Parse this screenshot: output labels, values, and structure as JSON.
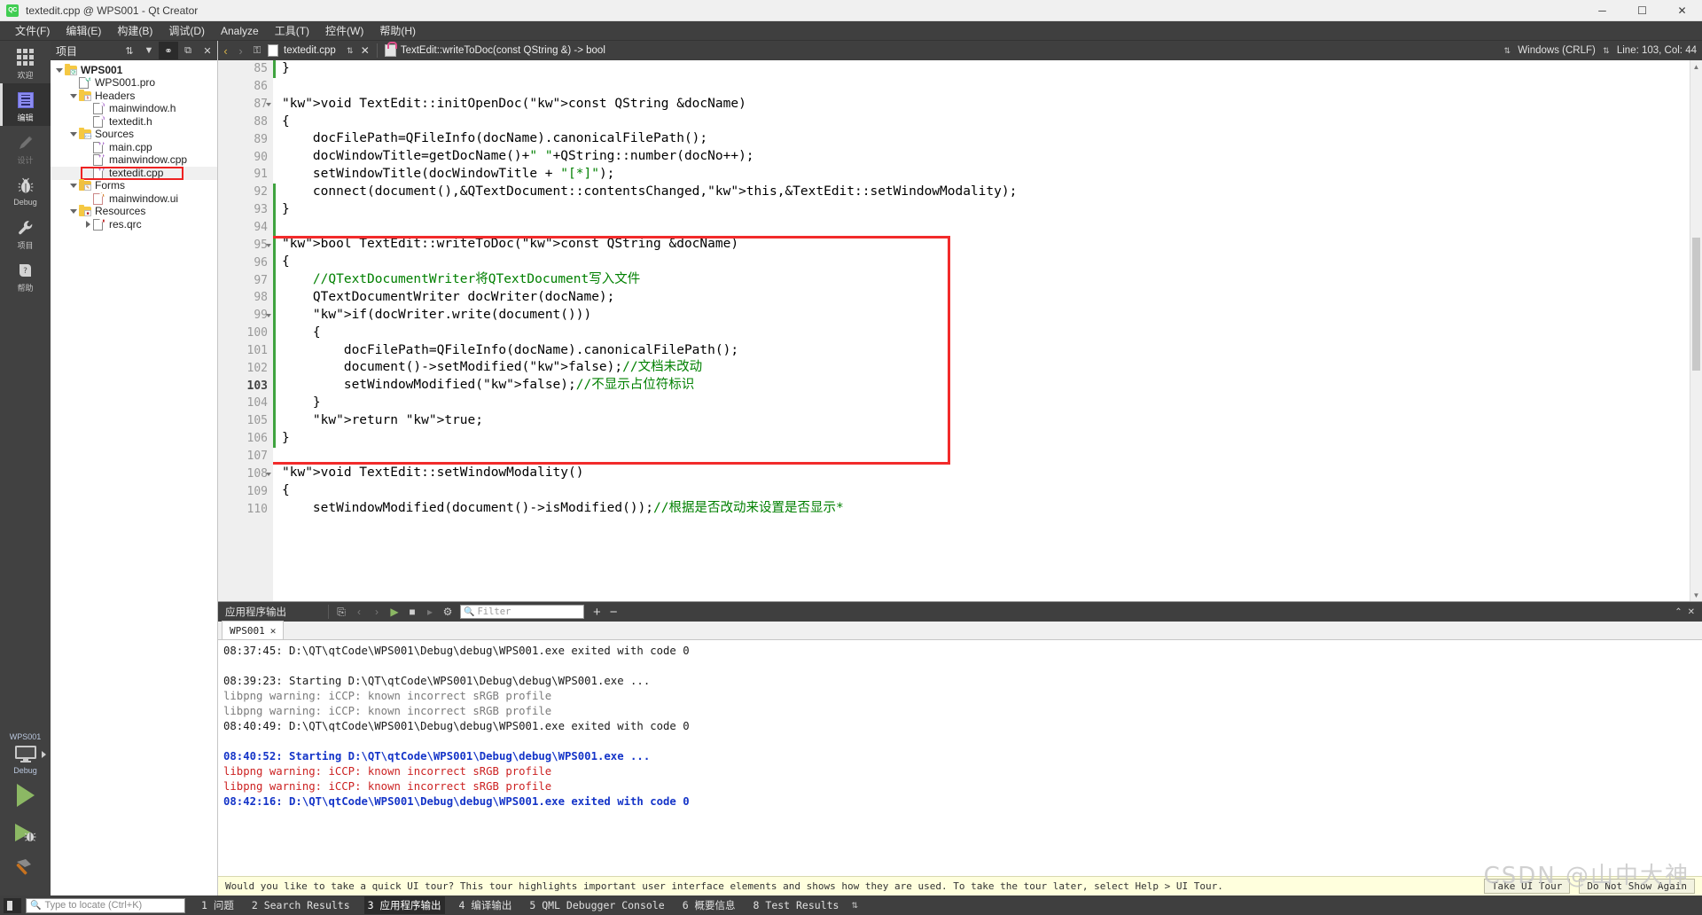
{
  "window": {
    "title": "textedit.cpp @ WPS001 - Qt Creator",
    "logo_text": "QC",
    "minimize": "─",
    "maximize": "☐",
    "close": "✕"
  },
  "menubar": {
    "items": [
      {
        "label": "文件(F)",
        "name": "menu-file"
      },
      {
        "label": "编辑(E)",
        "name": "menu-edit"
      },
      {
        "label": "构建(B)",
        "name": "menu-build"
      },
      {
        "label": "调试(D)",
        "name": "menu-debug"
      },
      {
        "label": "Analyze",
        "name": "menu-analyze"
      },
      {
        "label": "工具(T)",
        "name": "menu-tools"
      },
      {
        "label": "控件(W)",
        "name": "menu-window"
      },
      {
        "label": "帮助(H)",
        "name": "menu-help"
      }
    ]
  },
  "modebar": {
    "modes": [
      {
        "label": "欢迎",
        "icon": "grid-icon",
        "active": false,
        "disabled": false
      },
      {
        "label": "编辑",
        "icon": "document-icon",
        "active": true,
        "disabled": false
      },
      {
        "label": "设计",
        "icon": "pencil-icon",
        "active": false,
        "disabled": true
      },
      {
        "label": "Debug",
        "icon": "bug-icon",
        "active": false,
        "disabled": false
      },
      {
        "label": "项目",
        "icon": "wrench-icon",
        "active": false,
        "disabled": false
      },
      {
        "label": "帮助",
        "icon": "help-icon",
        "active": false,
        "disabled": false
      }
    ],
    "kit": {
      "project_name": "WPS001",
      "build_config": "Debug"
    },
    "run_buttons": [
      {
        "name": "run-button",
        "label": "Run"
      },
      {
        "name": "start-debugging-button",
        "label": "Start Debugging"
      },
      {
        "name": "build-button",
        "label": "Build"
      }
    ]
  },
  "project_dock": {
    "title": "项目",
    "toolbar": [
      {
        "name": "sort-toggle-button",
        "glyph": "⇅"
      },
      {
        "name": "filter-button",
        "glyph": "▼"
      },
      {
        "name": "link-with-editor-button",
        "glyph": "⚭",
        "active": true
      },
      {
        "name": "split-button",
        "glyph": "⧉"
      },
      {
        "name": "close-sidebar-button",
        "glyph": "✕"
      }
    ],
    "tree": [
      {
        "label": "WPS001",
        "indent": 0,
        "twisty": "down",
        "icon": "project-folder-icon",
        "bold": true,
        "selected": false,
        "highlight": false
      },
      {
        "label": "WPS001.pro",
        "indent": 1,
        "twisty": "none",
        "icon": "pro-file-icon",
        "bold": false,
        "selected": false,
        "highlight": false
      },
      {
        "label": "Headers",
        "indent": 1,
        "twisty": "down",
        "icon": "headers-folder-icon",
        "bold": false,
        "selected": false,
        "highlight": false
      },
      {
        "label": "mainwindow.h",
        "indent": 2,
        "twisty": "none",
        "icon": "h-file-icon",
        "bold": false,
        "selected": false,
        "highlight": false
      },
      {
        "label": "textedit.h",
        "indent": 2,
        "twisty": "none",
        "icon": "h-file-icon",
        "bold": false,
        "selected": false,
        "highlight": false
      },
      {
        "label": "Sources",
        "indent": 1,
        "twisty": "down",
        "icon": "sources-folder-icon",
        "bold": false,
        "selected": false,
        "highlight": false
      },
      {
        "label": "main.cpp",
        "indent": 2,
        "twisty": "none",
        "icon": "cpp-file-icon",
        "bold": false,
        "selected": false,
        "highlight": false
      },
      {
        "label": "mainwindow.cpp",
        "indent": 2,
        "twisty": "none",
        "icon": "cpp-file-icon",
        "bold": false,
        "selected": false,
        "highlight": false
      },
      {
        "label": "textedit.cpp",
        "indent": 2,
        "twisty": "none",
        "icon": "cpp-file-icon",
        "bold": false,
        "selected": true,
        "highlight": true
      },
      {
        "label": "Forms",
        "indent": 1,
        "twisty": "down",
        "icon": "forms-folder-icon",
        "bold": false,
        "selected": false,
        "highlight": false
      },
      {
        "label": "mainwindow.ui",
        "indent": 2,
        "twisty": "none",
        "icon": "ui-file-icon",
        "bold": false,
        "selected": false,
        "highlight": false
      },
      {
        "label": "Resources",
        "indent": 1,
        "twisty": "down",
        "icon": "resources-folder-icon",
        "bold": false,
        "selected": false,
        "highlight": false
      },
      {
        "label": "res.qrc",
        "indent": 2,
        "twisty": "right",
        "icon": "qrc-file-icon",
        "bold": false,
        "selected": false,
        "highlight": false
      }
    ]
  },
  "editor_toolbar": {
    "back_glyph": "‹",
    "forward_glyph": "›",
    "lock_glyph": "⚿",
    "tab_name": "textedit.cpp",
    "combo_glyph": "⇅",
    "close_glyph": "✕",
    "symbol": "TextEdit::writeToDoc(const QString &) -> bool",
    "line_ending": "Windows (CRLF)",
    "cursor_pos": "Line: 103, Col: 44",
    "split_glyph": "⇅"
  },
  "code": {
    "first_line": 85,
    "current_line": 103,
    "lines": [
      {
        "n": 85,
        "fold": "",
        "text": "}",
        "changed": true
      },
      {
        "n": 86,
        "fold": "",
        "text": "",
        "changed": false
      },
      {
        "n": 87,
        "fold": "down",
        "text": "void TextEdit::initOpenDoc(const QString &docName)",
        "changed": false
      },
      {
        "n": 88,
        "fold": "",
        "text": "{",
        "changed": false
      },
      {
        "n": 89,
        "fold": "",
        "text": "    docFilePath=QFileInfo(docName).canonicalFilePath();",
        "changed": false
      },
      {
        "n": 90,
        "fold": "",
        "text": "    docWindowTitle=getDocName()+\" \"+QString::number(docNo++);",
        "changed": false
      },
      {
        "n": 91,
        "fold": "",
        "text": "    setWindowTitle(docWindowTitle + \"[*]\");",
        "changed": false
      },
      {
        "n": 92,
        "fold": "",
        "text": "    connect(document(),&QTextDocument::contentsChanged,this,&TextEdit::setWindowModality);",
        "changed": true
      },
      {
        "n": 93,
        "fold": "",
        "text": "}",
        "changed": true
      },
      {
        "n": 94,
        "fold": "",
        "text": "",
        "changed": true
      },
      {
        "n": 95,
        "fold": "down",
        "text": "bool TextEdit::writeToDoc(const QString &docName)",
        "changed": true
      },
      {
        "n": 96,
        "fold": "",
        "text": "{",
        "changed": true
      },
      {
        "n": 97,
        "fold": "",
        "text": "    //QTextDocumentWriter将QTextDocument写入文件",
        "changed": true
      },
      {
        "n": 98,
        "fold": "",
        "text": "    QTextDocumentWriter docWriter(docName);",
        "changed": true
      },
      {
        "n": 99,
        "fold": "down",
        "text": "    if(docWriter.write(document()))",
        "changed": true
      },
      {
        "n": 100,
        "fold": "",
        "text": "    {",
        "changed": true
      },
      {
        "n": 101,
        "fold": "",
        "text": "        docFilePath=QFileInfo(docName).canonicalFilePath();",
        "changed": true
      },
      {
        "n": 102,
        "fold": "",
        "text": "        document()->setModified(false);//文档未改动",
        "changed": true
      },
      {
        "n": 103,
        "fold": "",
        "text": "        setWindowModified(false);//不显示占位符标识",
        "changed": true
      },
      {
        "n": 104,
        "fold": "",
        "text": "    }",
        "changed": true
      },
      {
        "n": 105,
        "fold": "",
        "text": "    return true;",
        "changed": true
      },
      {
        "n": 106,
        "fold": "",
        "text": "}",
        "changed": true
      },
      {
        "n": 107,
        "fold": "",
        "text": "",
        "changed": false
      },
      {
        "n": 108,
        "fold": "down",
        "text": "void TextEdit::setWindowModality()",
        "changed": false
      },
      {
        "n": 109,
        "fold": "",
        "text": "{",
        "changed": false
      },
      {
        "n": 110,
        "fold": "",
        "text": "    setWindowModified(document()->isModified());//根据是否改动来设置是否显示*",
        "changed": false
      }
    ],
    "annotation_box": {
      "from_line": 95,
      "to_line": 107,
      "color": "#f22b2b"
    }
  },
  "output_pane": {
    "title": "应用程序输出",
    "toolbar": [
      {
        "name": "clear-output-button",
        "glyph": "⎘"
      },
      {
        "name": "prev-item-button",
        "glyph": "‹"
      },
      {
        "name": "next-item-button",
        "glyph": "›"
      },
      {
        "name": "run-output-button",
        "glyph": "▶"
      },
      {
        "name": "stop-output-button",
        "glyph": "■"
      },
      {
        "name": "attach-debugger-button",
        "glyph": "▸"
      },
      {
        "name": "output-settings-button",
        "glyph": "⚙"
      }
    ],
    "filter_placeholder": "Filter",
    "zoom_in_glyph": "+",
    "zoom_out_glyph": "−",
    "maximize_glyph": "⌃",
    "close_glyph": "✕",
    "tabs": [
      {
        "label": "WPS001",
        "close": "✕",
        "active": true
      }
    ],
    "log": [
      {
        "text": "08:37:45: D:\\QT\\qtCode\\WPS001\\Debug\\debug\\WPS001.exe exited with code 0",
        "style": "dark"
      },
      {
        "text": "",
        "style": "dark"
      },
      {
        "text": "08:39:23: Starting D:\\QT\\qtCode\\WPS001\\Debug\\debug\\WPS001.exe ...",
        "style": "dark"
      },
      {
        "text": "libpng warning: iCCP: known incorrect sRGB profile",
        "style": "gray"
      },
      {
        "text": "libpng warning: iCCP: known incorrect sRGB profile",
        "style": "gray"
      },
      {
        "text": "08:40:49: D:\\QT\\qtCode\\WPS001\\Debug\\debug\\WPS001.exe exited with code 0",
        "style": "dark"
      },
      {
        "text": "",
        "style": "dark"
      },
      {
        "text": "08:40:52: Starting D:\\QT\\qtCode\\WPS001\\Debug\\debug\\WPS001.exe ...",
        "style": "blue"
      },
      {
        "text": "libpng warning: iCCP: known incorrect sRGB profile",
        "style": "red"
      },
      {
        "text": "libpng warning: iCCP: known incorrect sRGB profile",
        "style": "red"
      },
      {
        "text": "08:42:16: D:\\QT\\qtCode\\WPS001\\Debug\\debug\\WPS001.exe exited with code 0",
        "style": "blue"
      }
    ]
  },
  "tour_banner": {
    "text": "Would you like to take a quick UI tour? This tour highlights important user interface elements and shows how they are used. To take the tour later, select Help > UI Tour.",
    "take_tour_label": "Take UI Tour",
    "dont_show_label": "Do Not Show Again"
  },
  "statusbar": {
    "sidebar_toggle_name": "toggle-sidebar-button",
    "locator_placeholder": "Type to locate (Ctrl+K)",
    "tabs": [
      {
        "num": "1",
        "label": "问题",
        "active": false
      },
      {
        "num": "2",
        "label": "Search Results",
        "active": false
      },
      {
        "num": "3",
        "label": "应用程序输出",
        "active": true
      },
      {
        "num": "4",
        "label": "编译输出",
        "active": false
      },
      {
        "num": "5",
        "label": "QML Debugger Console",
        "active": false
      },
      {
        "num": "6",
        "label": "概要信息",
        "active": false
      },
      {
        "num": "8",
        "label": "Test Results",
        "active": false
      }
    ],
    "more_glyph": "⇅"
  },
  "watermark": {
    "text": "CSDN @山中大神"
  },
  "colors": {
    "accent_green": "#41cd52",
    "annotation_red": "#f22b2b",
    "chrome_dark": "#3f3f3f",
    "keyword": "#808000",
    "comment": "#008000",
    "changebar": "#3fa33f"
  }
}
